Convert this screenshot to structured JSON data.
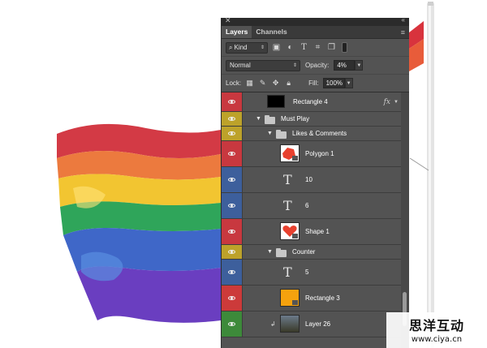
{
  "panel": {
    "tabs": [
      {
        "label": "Layers",
        "active": true
      },
      {
        "label": "Channels",
        "active": false
      }
    ],
    "filter": {
      "kind_label": "Kind"
    },
    "blend": {
      "mode": "Normal",
      "opacity_label": "Opacity:",
      "opacity_value": "4%"
    },
    "lock": {
      "lock_label": "Lock:",
      "fill_label": "Fill:",
      "fill_value": "100%"
    },
    "layers": [
      {
        "name": "Rectangle 4",
        "type": "shape",
        "tag_color": "#c8383f",
        "fx": "fx"
      },
      {
        "name": "Must Play",
        "type": "group",
        "tag_color": "#bda22a"
      },
      {
        "name": "Likes & Comments",
        "type": "group",
        "tag_color": "#bda22a"
      },
      {
        "name": "Polygon 1",
        "type": "shape",
        "tag_color": "#c8383f"
      },
      {
        "name": "10",
        "type": "text",
        "tag_color": "#3d5f9c"
      },
      {
        "name": "6",
        "type": "text",
        "tag_color": "#3d5f9c"
      },
      {
        "name": "Shape 1",
        "type": "shape",
        "tag_color": "#c8383f"
      },
      {
        "name": "Counter",
        "type": "group",
        "tag_color": "#bda22a"
      },
      {
        "name": "5",
        "type": "text",
        "tag_color": "#3d5f9c"
      },
      {
        "name": "Rectangle 3",
        "type": "shape",
        "tag_color": "#cc3a3a"
      },
      {
        "name": "Layer 26",
        "type": "image",
        "tag_color": "#3d8a3a"
      }
    ]
  },
  "watermark": {
    "title": "思洋互动",
    "url": "www.ciya.cn"
  }
}
